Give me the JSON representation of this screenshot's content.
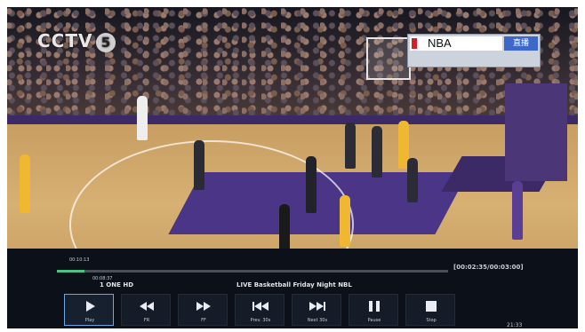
{
  "overlay": {
    "channel_logo": "CCTV",
    "channel_number": "5",
    "scoreboard_label": "NBA",
    "scoreboard_badge": "直播"
  },
  "player": {
    "time_elapsed": "00:10:13",
    "time_marker": "00:08:37",
    "time_range": "[00:02:35/00:03:00]",
    "progress": 0.07,
    "channel_name": "1 ONE HD",
    "program_title": "LIVE Basketball Friday Night NBL",
    "clock": "21:33",
    "buttons": [
      {
        "label": "Play",
        "icon": "play-icon"
      },
      {
        "label": "FR",
        "icon": "fast-rewind-icon"
      },
      {
        "label": "FF",
        "icon": "fast-forward-icon"
      },
      {
        "label": "Prev. 30s",
        "icon": "skip-back-icon"
      },
      {
        "label": "Next 30s",
        "icon": "skip-forward-icon"
      },
      {
        "label": "Pause",
        "icon": "pause-icon"
      },
      {
        "label": "Stop",
        "icon": "stop-icon"
      }
    ]
  },
  "colors": {
    "accent": "#6aa7e8",
    "progress": "#4bc28a"
  }
}
